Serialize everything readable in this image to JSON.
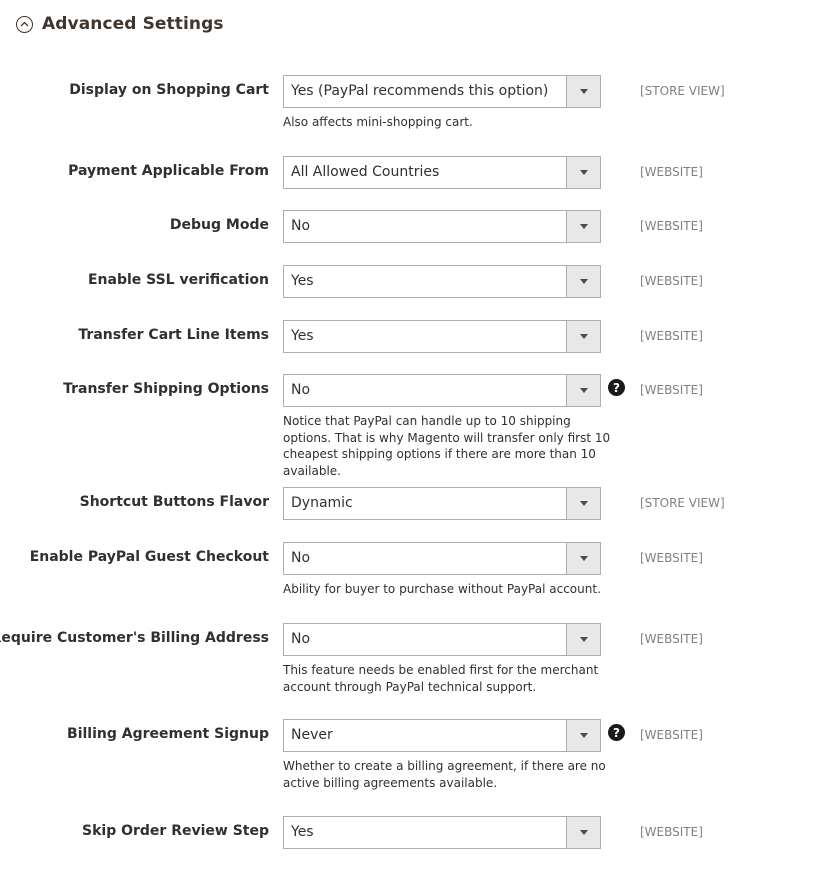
{
  "section": {
    "title": "Advanced Settings"
  },
  "fields": [
    {
      "label": "Display on Shopping Cart",
      "value": "Yes (PayPal recommends this option)",
      "scope": "[STORE VIEW]",
      "note": "Also affects mini-shopping cart."
    },
    {
      "label": "Payment Applicable From",
      "value": "All Allowed Countries",
      "scope": "[WEBSITE]"
    },
    {
      "label": "Debug Mode",
      "value": "No",
      "scope": "[WEBSITE]"
    },
    {
      "label": "Enable SSL verification",
      "value": "Yes",
      "scope": "[WEBSITE]"
    },
    {
      "label": "Transfer Cart Line Items",
      "value": "Yes",
      "scope": "[WEBSITE]"
    },
    {
      "label": "Transfer Shipping Options",
      "value": "No",
      "scope": "[WEBSITE]",
      "help": "?",
      "note": "Notice that PayPal can handle up to 10 shipping options. That is why Magento will transfer only first 10 cheapest shipping options if there are more than 10 available."
    },
    {
      "label": "Shortcut Buttons Flavor",
      "value": "Dynamic",
      "scope": "[STORE VIEW]"
    },
    {
      "label": "Enable PayPal Guest Checkout",
      "value": "No",
      "scope": "[WEBSITE]",
      "note": "Ability for buyer to purchase without PayPal account."
    },
    {
      "label": "Require Customer's Billing Address",
      "value": "No",
      "scope": "[WEBSITE]",
      "note": "This feature needs be enabled first for the merchant account through PayPal technical support."
    },
    {
      "label": "Billing Agreement Signup",
      "value": "Never",
      "scope": "[WEBSITE]",
      "help": "?",
      "note": "Whether to create a billing agreement, if there are no active billing agreements available."
    },
    {
      "label": "Skip Order Review Step",
      "value": "Yes",
      "scope": "[WEBSITE]"
    }
  ]
}
